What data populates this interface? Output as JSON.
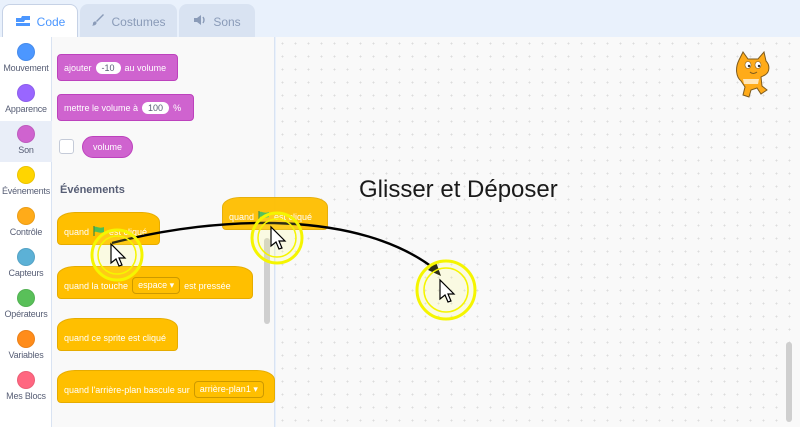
{
  "tabs": [
    {
      "label": "Code",
      "icon": "code-icon",
      "active": true
    },
    {
      "label": "Costumes",
      "icon": "brush-icon",
      "active": false
    },
    {
      "label": "Sons",
      "icon": "speaker-icon",
      "active": false
    }
  ],
  "categories": [
    {
      "label": "Mouvement",
      "color": "#4c97ff"
    },
    {
      "label": "Apparence",
      "color": "#9966ff"
    },
    {
      "label": "Son",
      "color": "#cf63cf"
    },
    {
      "label": "Événements",
      "color": "#ffd500"
    },
    {
      "label": "Contrôle",
      "color": "#ffab19"
    },
    {
      "label": "Capteurs",
      "color": "#5cb1d6"
    },
    {
      "label": "Opérateurs",
      "color": "#59c059"
    },
    {
      "label": "Variables",
      "color": "#ff8c1a"
    },
    {
      "label": "Mes Blocs",
      "color": "#ff6680"
    }
  ],
  "palette": {
    "sound_blocks": {
      "change_volume": {
        "prefix": "ajouter",
        "value": "-10",
        "suffix": "au volume"
      },
      "set_volume": {
        "prefix": "mettre le volume à",
        "value": "100",
        "suffix": "%"
      },
      "volume_reporter": "volume"
    },
    "events_title": "Événements",
    "event_blocks": {
      "when_flag": {
        "prefix": "quand",
        "suffix": "est cliqué"
      },
      "when_key": {
        "prefix": "quand la touche",
        "dropdown": "espace",
        "suffix": "est pressée"
      },
      "when_sprite_clicked": "quand ce sprite est cliqué",
      "when_backdrop": {
        "prefix": "quand l'arrière-plan bascule sur",
        "dropdown": "arrière-plan1"
      }
    }
  },
  "workspace": {
    "caption": "Glisser et Déposer",
    "dragged_block": {
      "prefix": "quand",
      "suffix": "est cliqué"
    }
  },
  "colors": {
    "accent": "#4c97ff",
    "highlight_ring": "#ffff00",
    "sound": "#cf63cf",
    "event": "#ffbf00"
  }
}
